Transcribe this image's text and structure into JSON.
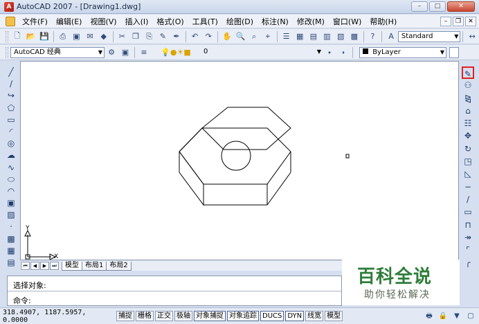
{
  "window": {
    "title": "AutoCAD 2007 - [Drawing1.dwg]"
  },
  "menus": [
    "文件(F)",
    "编辑(E)",
    "视图(V)",
    "插入(I)",
    "格式(O)",
    "工具(T)",
    "绘图(D)",
    "标注(N)",
    "修改(M)",
    "窗口(W)",
    "帮助(H)"
  ],
  "toolbar": {
    "text_style": "Standard",
    "workspace": "AutoCAD 经典",
    "layer": "0",
    "color": "ByLayer"
  },
  "left_tools": [
    "line-icon",
    "construction-line-icon",
    "polyline-icon",
    "polygon-icon",
    "rectangle-icon",
    "arc-icon",
    "circle-icon",
    "revision-cloud-icon",
    "spline-icon",
    "ellipse-icon",
    "ellipse-arc-icon",
    "insert-block-icon",
    "make-block-icon",
    "point-icon",
    "hatch-icon",
    "region-icon"
  ],
  "right_tools": [
    "erase-icon",
    "copy-icon",
    "mirror-icon",
    "offset-icon",
    "array-icon",
    "move-icon",
    "rotate-icon",
    "scale-icon",
    "stretch-icon",
    "trim-icon",
    "extend-icon",
    "break-icon",
    "break-at-point-icon",
    "join-icon",
    "chamfer-icon",
    "fillet-icon"
  ],
  "tabs": {
    "model": "模型",
    "layout1": "布局1",
    "layout2": "布局2"
  },
  "ucs": {
    "x_label": "X",
    "y_label": "Y"
  },
  "command": {
    "line1": "选择对象:",
    "line2": "命令:"
  },
  "watermark": {
    "title": "百科全说",
    "subtitle": "助你轻松解决"
  },
  "status": {
    "coords": "318.4907, 1187.5957, 0.0000",
    "buttons": [
      "捕捉",
      "栅格",
      "正交",
      "极轴",
      "对象捕捉",
      "对象追踪",
      "DUCS",
      "DYN",
      "线宽",
      "模型"
    ]
  },
  "colors": {
    "highlight": "#e0231c",
    "watermark_green": "#2e7d3a"
  }
}
